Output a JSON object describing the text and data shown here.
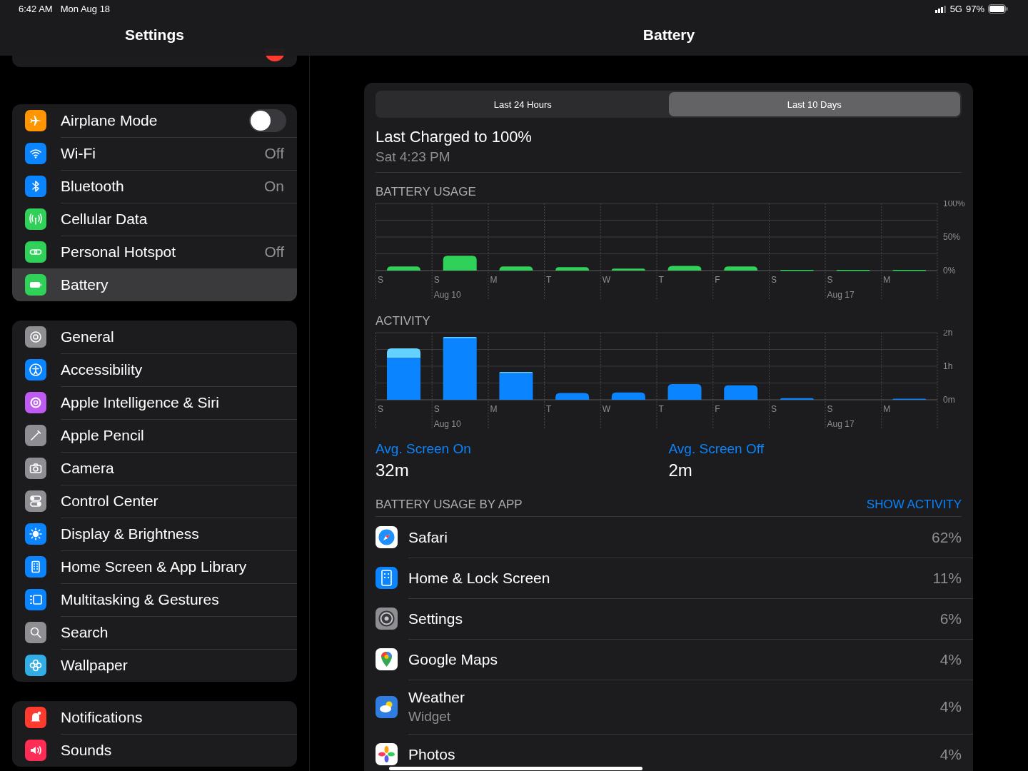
{
  "status_bar": {
    "time": "6:42 AM",
    "date": "Mon Aug 18",
    "network": "5G",
    "battery": "97%"
  },
  "sidebar": {
    "title": "Settings",
    "groups": [
      {
        "items": [
          {
            "label": "Airplane Mode",
            "color": "#ff9500",
            "kind": "toggle",
            "on": false,
            "selected": false
          },
          {
            "label": "Wi-Fi",
            "color": "#0a84ff",
            "kind": "value",
            "value": "Off",
            "selected": false
          },
          {
            "label": "Bluetooth",
            "color": "#0a84ff",
            "kind": "value",
            "value": "On",
            "selected": false
          },
          {
            "label": "Cellular Data",
            "color": "#30d158",
            "kind": "plain",
            "selected": false
          },
          {
            "label": "Personal Hotspot",
            "color": "#30d158",
            "kind": "value",
            "value": "Off",
            "selected": false
          },
          {
            "label": "Battery",
            "color": "#30d158",
            "kind": "plain",
            "selected": true
          }
        ]
      },
      {
        "items": [
          {
            "label": "General",
            "color": "#8e8e93",
            "kind": "plain",
            "selected": false
          },
          {
            "label": "Accessibility",
            "color": "#0a84ff",
            "kind": "plain",
            "selected": false
          },
          {
            "label": "Apple Intelligence & Siri",
            "color": "#bf5af2",
            "kind": "plain",
            "selected": false
          },
          {
            "label": "Apple Pencil",
            "color": "#8e8e93",
            "kind": "plain",
            "selected": false
          },
          {
            "label": "Camera",
            "color": "#8e8e93",
            "kind": "plain",
            "selected": false
          },
          {
            "label": "Control Center",
            "color": "#8e8e93",
            "kind": "plain",
            "selected": false
          },
          {
            "label": "Display & Brightness",
            "color": "#0a84ff",
            "kind": "plain",
            "selected": false
          },
          {
            "label": "Home Screen & App Library",
            "color": "#0a84ff",
            "kind": "plain",
            "selected": false
          },
          {
            "label": "Multitasking & Gestures",
            "color": "#0a84ff",
            "kind": "plain",
            "selected": false
          },
          {
            "label": "Search",
            "color": "#8e8e93",
            "kind": "plain",
            "selected": false
          },
          {
            "label": "Wallpaper",
            "color": "#32ade6",
            "kind": "plain",
            "selected": false
          }
        ]
      },
      {
        "items": [
          {
            "label": "Notifications",
            "color": "#ff3b30",
            "kind": "plain",
            "selected": false
          },
          {
            "label": "Sounds",
            "color": "#ff2d55",
            "kind": "plain",
            "selected": false
          }
        ]
      }
    ]
  },
  "detail": {
    "title": "Battery",
    "tabs": [
      {
        "label": "Last 24 Hours",
        "selected": false
      },
      {
        "label": "Last 10 Days",
        "selected": true
      }
    ],
    "last_charged": {
      "title": "Last Charged to 100%",
      "time": "Sat 4:23 PM"
    },
    "battery_usage": {
      "chart_data": {
        "type": "bar",
        "title": "BATTERY USAGE",
        "categories": [
          "S",
          "S",
          "M",
          "T",
          "W",
          "T",
          "F",
          "S",
          "S",
          "M"
        ],
        "annotations": [
          "Aug 10",
          "Aug 17"
        ],
        "values": [
          6,
          22,
          6,
          5,
          3,
          7,
          6,
          1,
          1,
          1
        ],
        "ylim": [
          0,
          100
        ],
        "yticks": [
          {
            "value": 0,
            "label": "0%"
          },
          {
            "value": 50,
            "label": "50%"
          },
          {
            "value": 100,
            "label": "100%"
          }
        ]
      }
    },
    "activity": {
      "chart_data": {
        "type": "bar",
        "stacked": true,
        "title": "ACTIVITY",
        "categories": [
          "S",
          "S",
          "M",
          "T",
          "W",
          "T",
          "F",
          "S",
          "S",
          "M"
        ],
        "annotations": [
          "Aug 10",
          "Aug 17"
        ],
        "series": [
          {
            "color": "#0a84ff",
            "values": [
              1.25,
              1.85,
              0.8,
              0.2,
              0.22,
              0.47,
              0.43,
              0.05,
              0,
              0.03
            ]
          },
          {
            "color": "#64d2ff",
            "values": [
              0.28,
              0.02,
              0.03,
              0,
              0,
              0,
              0,
              0,
              0,
              0
            ]
          }
        ],
        "ylim": [
          0,
          2
        ],
        "yticks": [
          {
            "value": 0,
            "label": "0m"
          },
          {
            "value": 1,
            "label": "1h"
          },
          {
            "value": 2,
            "label": "2h"
          }
        ]
      }
    },
    "averages": [
      {
        "label": "Avg. Screen On",
        "value": "32m"
      },
      {
        "label": "Avg. Screen Off",
        "value": "2m"
      }
    ],
    "usage_by_app": {
      "heading": "BATTERY USAGE BY APP",
      "action": "SHOW ACTIVITY",
      "apps": [
        {
          "name": "Safari",
          "percent": "62%"
        },
        {
          "name": "Home & Lock Screen",
          "percent": "11%"
        },
        {
          "name": "Settings",
          "percent": "6%"
        },
        {
          "name": "Google Maps",
          "percent": "4%"
        },
        {
          "name": "Weather",
          "subtitle": "Widget",
          "percent": "4%"
        },
        {
          "name": "Photos",
          "percent": "4%"
        }
      ]
    }
  }
}
